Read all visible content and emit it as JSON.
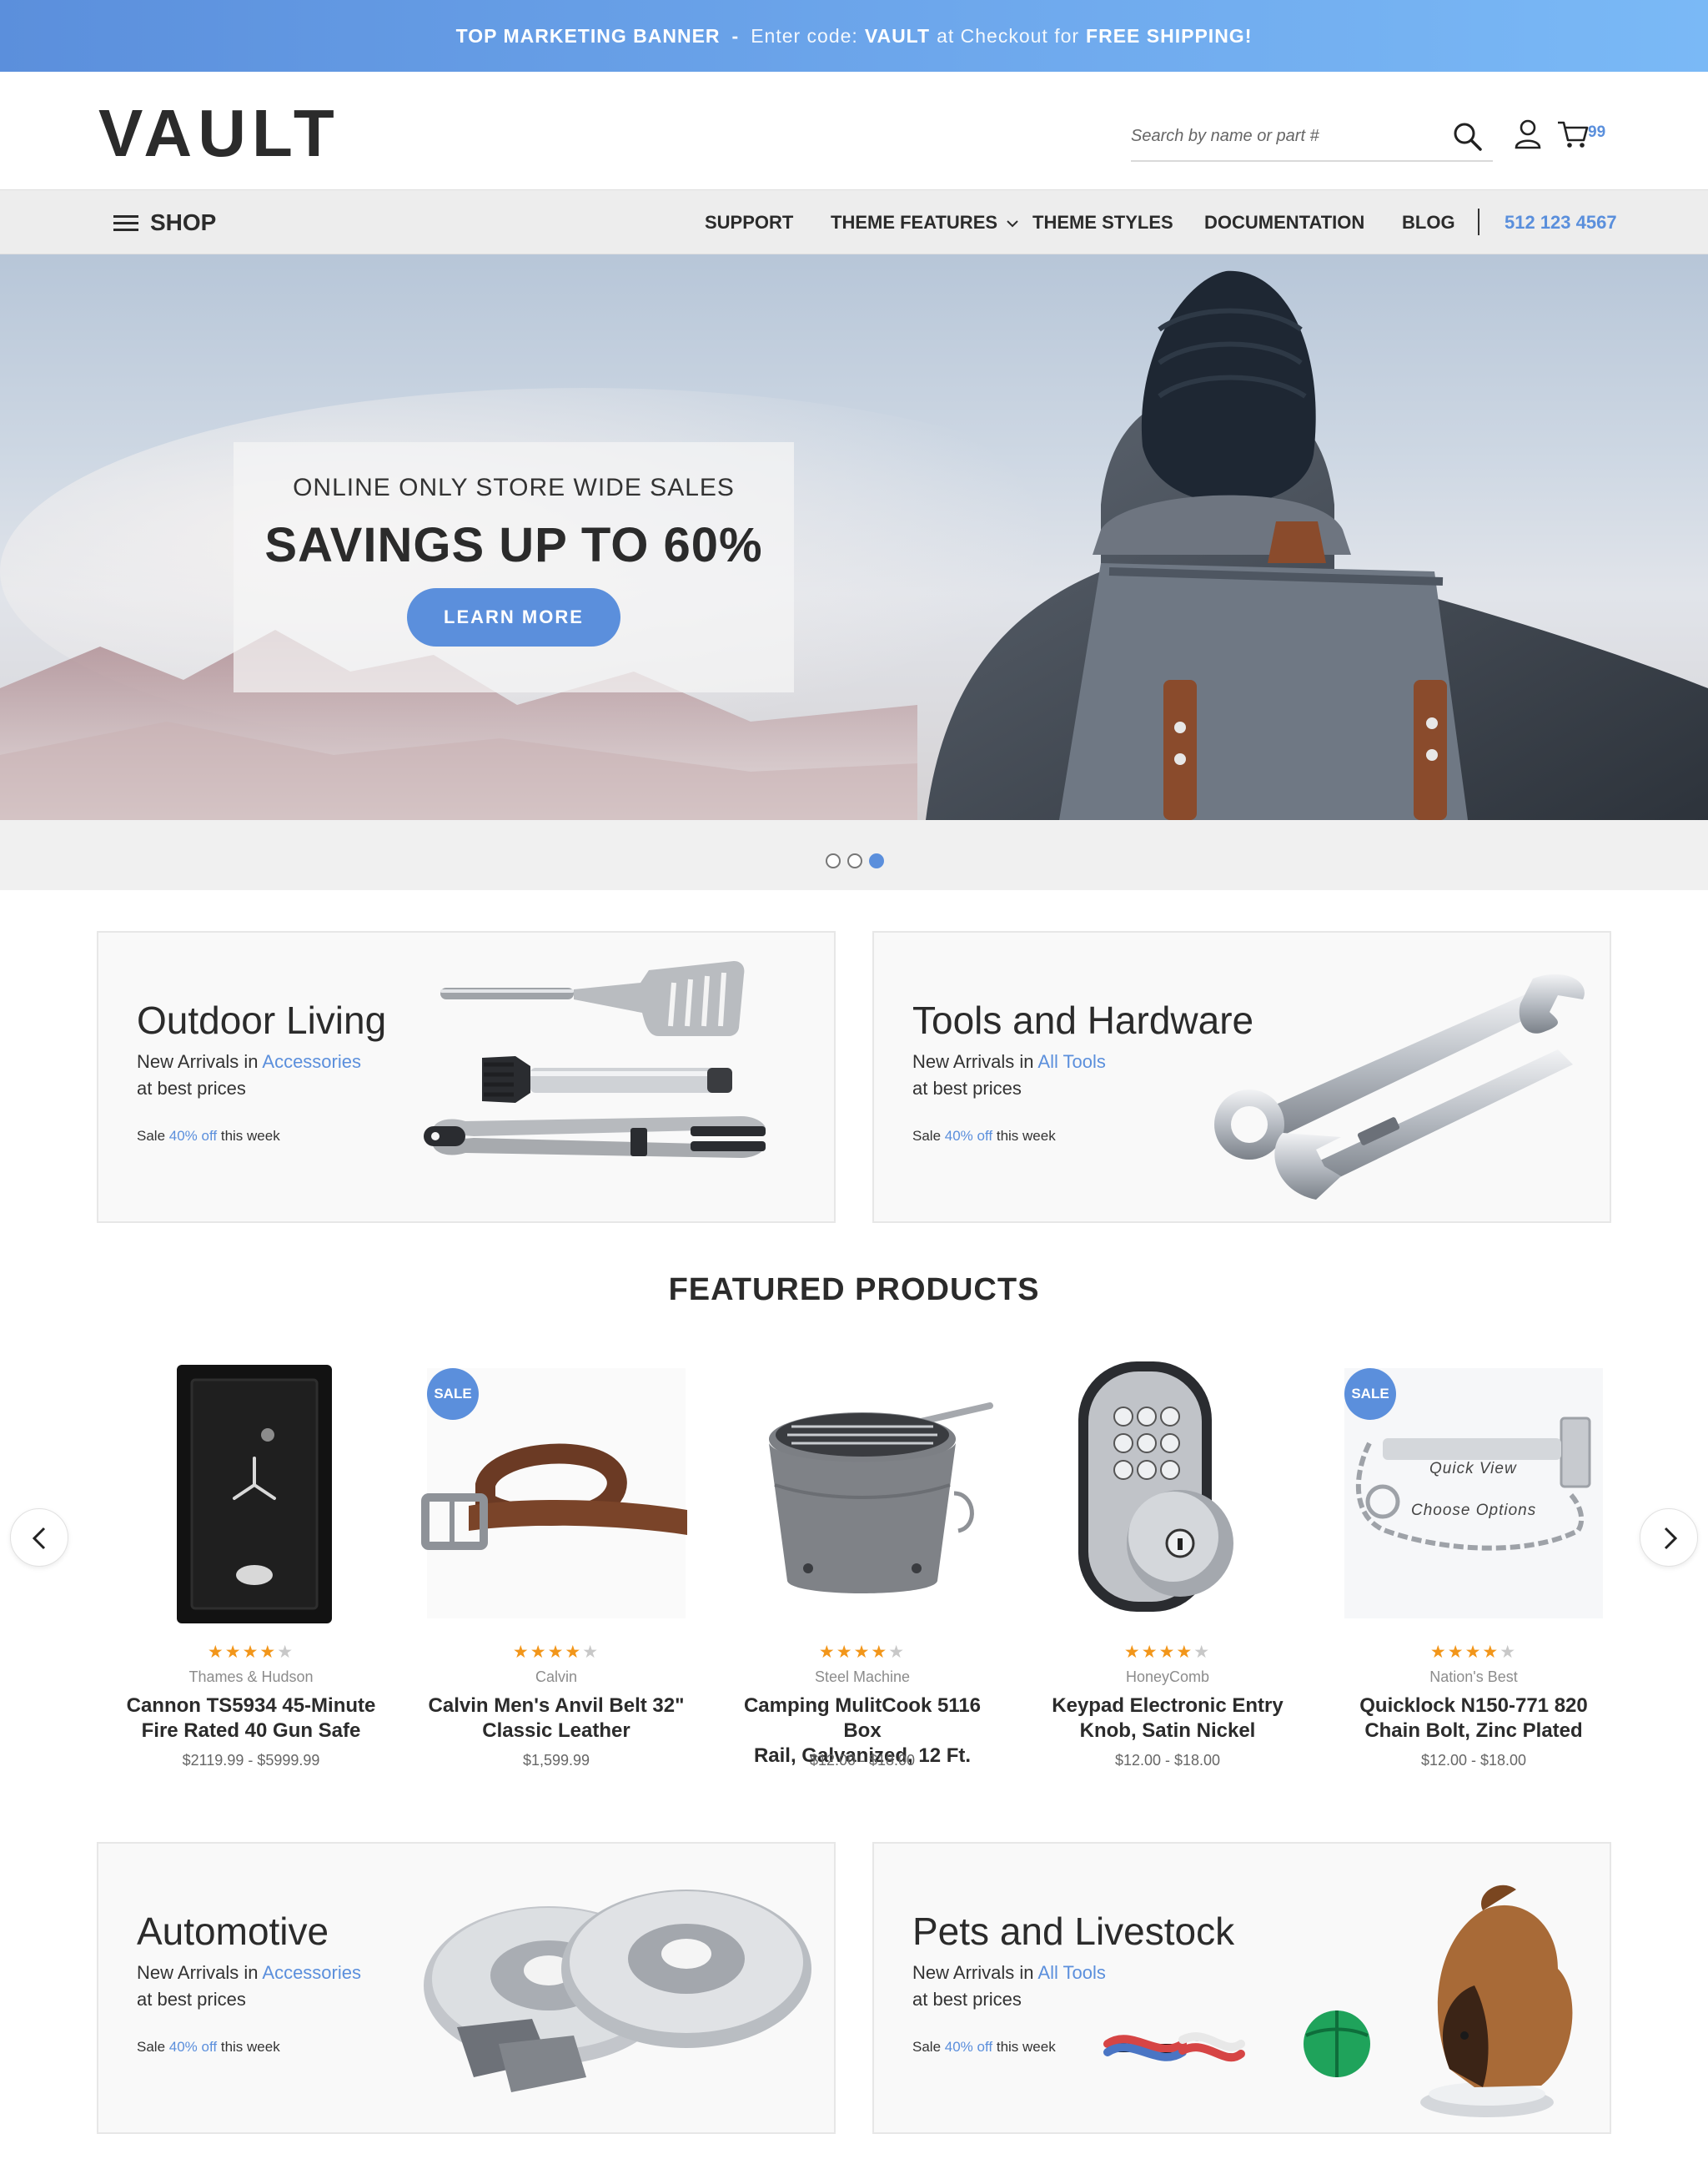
{
  "marketing_banner": {
    "label": "TOP MARKETING BANNER",
    "separator": "-",
    "text_before": "Enter code:",
    "code": "VAULT",
    "text_middle": "at Checkout for",
    "offer": "FREE SHIPPING!"
  },
  "header": {
    "logo": "VAULT",
    "search_placeholder": "Search by name or part #",
    "cart_count": "99"
  },
  "nav": {
    "shop_label": "SHOP",
    "items": [
      "SUPPORT",
      "THEME FEATURES",
      "THEME STYLES",
      "DOCUMENTATION",
      "BLOG"
    ],
    "phone": "512 123 4567"
  },
  "hero": {
    "subtitle": "ONLINE ONLY STORE WIDE SALES",
    "title": "SAVINGS UP TO 60%",
    "button": "LEARN MORE",
    "slide_count": 3,
    "active_slide": 3
  },
  "promos": [
    {
      "title": "Outdoor Living",
      "line1": "New Arrivals in",
      "link": "Accessories",
      "line2": "at best prices",
      "sale_prefix": "Sale",
      "sale_percent": "40% off",
      "sale_suffix": "this week"
    },
    {
      "title": "Tools and Hardware",
      "line1": "New Arrivals in",
      "link": "All Tools",
      "line2": "at best prices",
      "sale_prefix": "Sale",
      "sale_percent": "40% off",
      "sale_suffix": "this week"
    },
    {
      "title": "Automotive",
      "line1": "New Arrivals in",
      "link": "Accessories",
      "line2": "at best prices",
      "sale_prefix": "Sale",
      "sale_percent": "40% off",
      "sale_suffix": "this week"
    },
    {
      "title": "Pets and Livestock",
      "line1": "New Arrivals in",
      "link": "All Tools",
      "line2": "at best prices",
      "sale_prefix": "Sale",
      "sale_percent": "40% off",
      "sale_suffix": "this week"
    }
  ],
  "featured": {
    "title": "FEATURED PRODUCTS",
    "products": [
      {
        "brand": "Thames & Hudson",
        "name_line1": "Cannon TS5934 45-Minute",
        "name_line2": "Fire Rated 40 Gun Safe",
        "price": "$2119.99 - $5999.99",
        "rating": 4,
        "sale": ""
      },
      {
        "brand": "Calvin",
        "name_line1": "Calvin Men's Anvil Belt 32\"",
        "name_line2": "Classic Leather",
        "price": "$1,599.99",
        "rating": 4,
        "sale": "SALE"
      },
      {
        "brand": "Steel Machine",
        "name_line1": "Camping MulitCook 5116 Box",
        "name_line2": "Rail, Galvanized, 12 Ft.",
        "price": "$12.00 - $18.00",
        "rating": 4,
        "sale": ""
      },
      {
        "brand": "HoneyComb",
        "name_line1": "Keypad Electronic Entry",
        "name_line2": "Knob, Satin Nickel",
        "price": "$12.00 - $18.00",
        "rating": 4,
        "sale": ""
      },
      {
        "brand": "Nation's Best",
        "name_line1": "Quicklock N150-771 820",
        "name_line2": "Chain Bolt, Zinc Plated",
        "price": "$12.00 - $18.00",
        "rating": 4,
        "sale": "SALE",
        "quick_view": "Quick View",
        "choose_options": "Choose Options"
      }
    ]
  },
  "colors": {
    "accent": "#5b8fdc",
    "star": "#f2961a",
    "text": "#2b2b2b"
  },
  "icons": [
    "menu-icon",
    "search-icon",
    "user-icon",
    "cart-icon",
    "chevron-down-icon",
    "chevron-left-icon",
    "chevron-right-icon",
    "star-icon"
  ]
}
